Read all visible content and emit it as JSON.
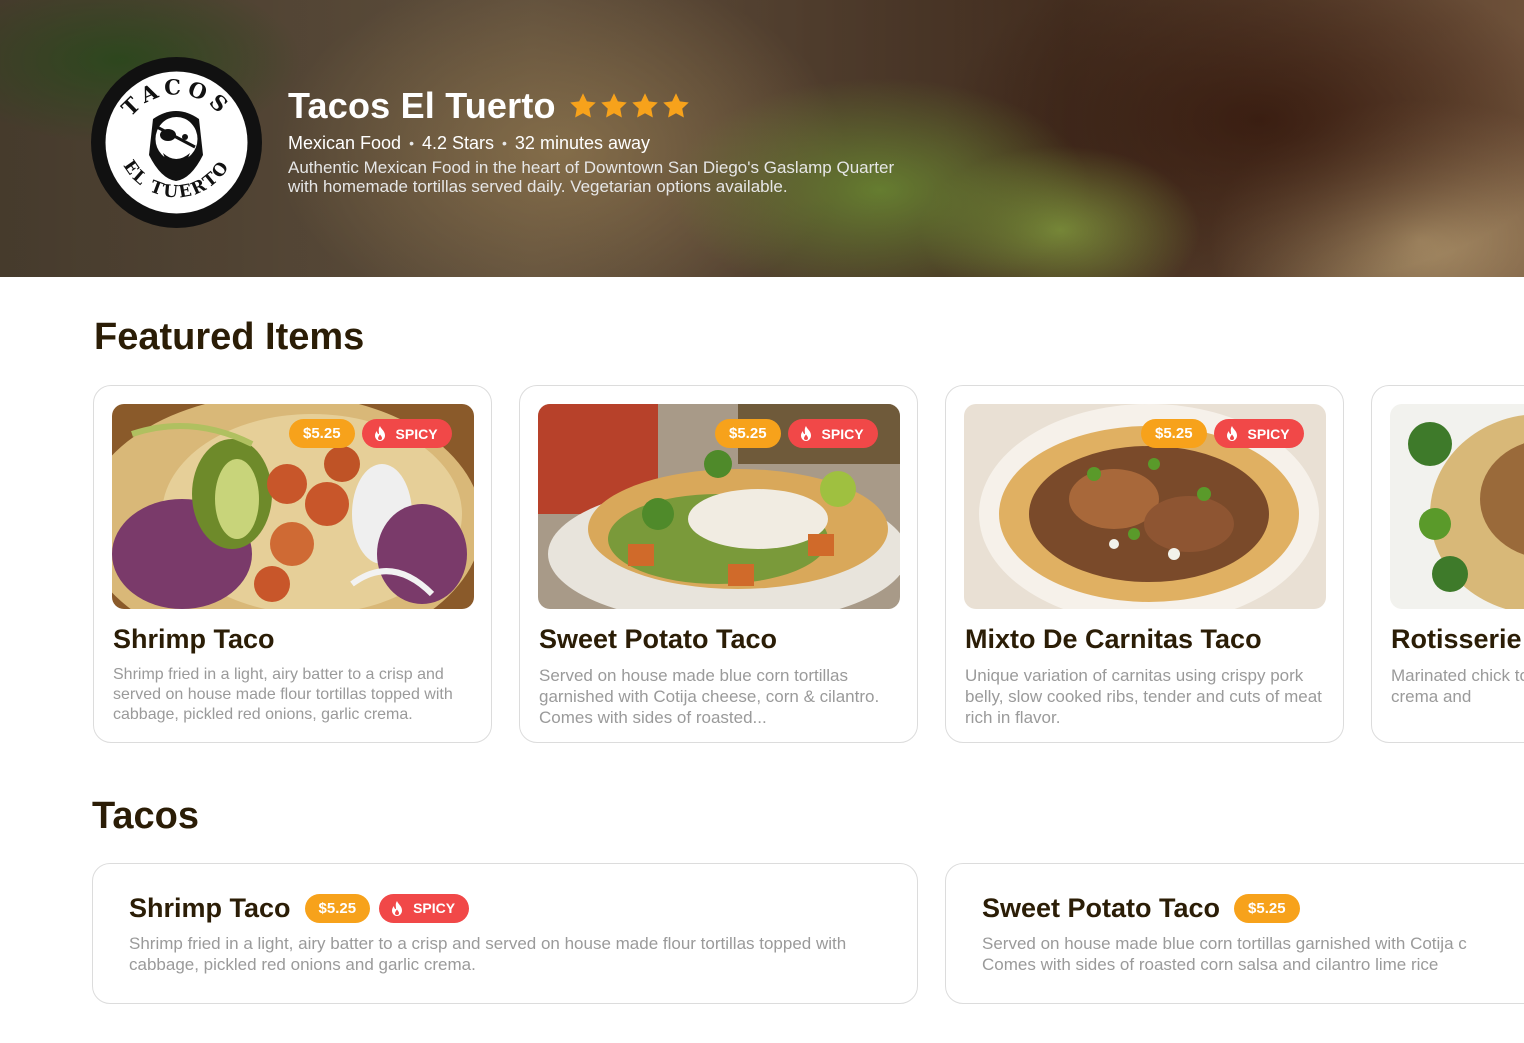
{
  "restaurant": {
    "name": "Tacos El Tuerto",
    "logo_text_top": "TACOS",
    "logo_text_bottom": "EL TUERTO",
    "rating_stars": 4,
    "cuisine": "Mexican Food",
    "rating_text": "4.2 Stars",
    "distance": "32 minutes away",
    "description": "Authentic Mexican Food in the heart of Downtown San Diego's Gaslamp Quarter with homemade tortillas served daily. Vegetarian options available.",
    "separator": "•"
  },
  "featured": {
    "title": "Featured Items",
    "items": [
      {
        "name": "Shrimp Taco",
        "price": "$5.25",
        "spicy_label": "SPICY",
        "description": "Shrimp fried in a light, airy batter to a crisp and served on house made flour tortillas topped with cabbage, pickled red onions, garlic crema."
      },
      {
        "name": "Sweet Potato Taco",
        "price": "$5.25",
        "spicy_label": "SPICY",
        "description": "Served on house made blue corn tortillas garnished with Cotija cheese, corn & cilantro. Comes with sides of roasted..."
      },
      {
        "name": "Mixto De Carnitas Taco",
        "price": "$5.25",
        "spicy_label": "SPICY",
        "description": "Unique variation of carnitas using crispy pork belly, slow cooked ribs, tender and cuts of meat rich in flavor."
      },
      {
        "name": "Rotisserie",
        "description": "Marinated chick tortillas topped garlic crema and"
      }
    ]
  },
  "tacos": {
    "title": "Tacos",
    "items": [
      {
        "name": "Shrimp Taco",
        "price": "$5.25",
        "spicy_label": "SPICY",
        "description": "Shrimp fried in a light, airy batter to a crisp and served on house made flour tortillas topped with cabbage, pickled red onions and garlic crema."
      },
      {
        "name": "Sweet Potato Taco",
        "price": "$5.25",
        "description_line1": "Served on house made blue corn tortillas garnished with Cotija c",
        "description_line2": "Comes with sides of roasted corn salsa and cilantro lime rice"
      }
    ]
  },
  "colors": {
    "price_badge": "#f7a21b",
    "spicy_badge": "#f14848",
    "star": "#f7a21b",
    "heading": "#2b1d06"
  }
}
